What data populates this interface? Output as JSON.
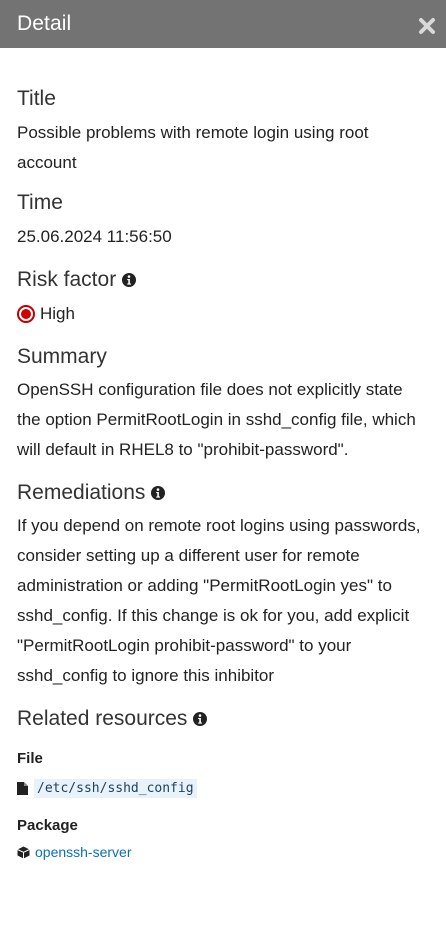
{
  "header": {
    "title": "Detail",
    "close_icon": "close-icon"
  },
  "sections": {
    "title": {
      "heading": "Title",
      "value": "Possible problems with remote login using root account"
    },
    "time": {
      "heading": "Time",
      "value": "25.06.2024 11:56:50"
    },
    "risk": {
      "heading": "Risk factor",
      "value": "High",
      "color": "#d00000"
    },
    "summary": {
      "heading": "Summary",
      "value": "OpenSSH configuration file does not explicitly state the option PermitRootLogin in sshd_config file, which will default in RHEL8 to \"prohibit-password\"."
    },
    "remediations": {
      "heading": "Remediations",
      "value": "If you depend on remote root logins using passwords, consider setting up a different user for remote administration or adding \"PermitRootLogin yes\" to sshd_config. If this change is ok for you, add explicit \"PermitRootLogin prohibit-password\" to your sshd_config to ignore this inhibitor"
    },
    "related": {
      "heading": "Related resources",
      "file_label": "File",
      "file_path": "/etc/ssh/sshd_config",
      "package_label": "Package",
      "package_name": "openssh-server"
    }
  },
  "colors": {
    "header_bg": "#737373",
    "link": "#0b6fb8",
    "risk_high": "#d00000",
    "code_bg": "#e8f2fb"
  }
}
